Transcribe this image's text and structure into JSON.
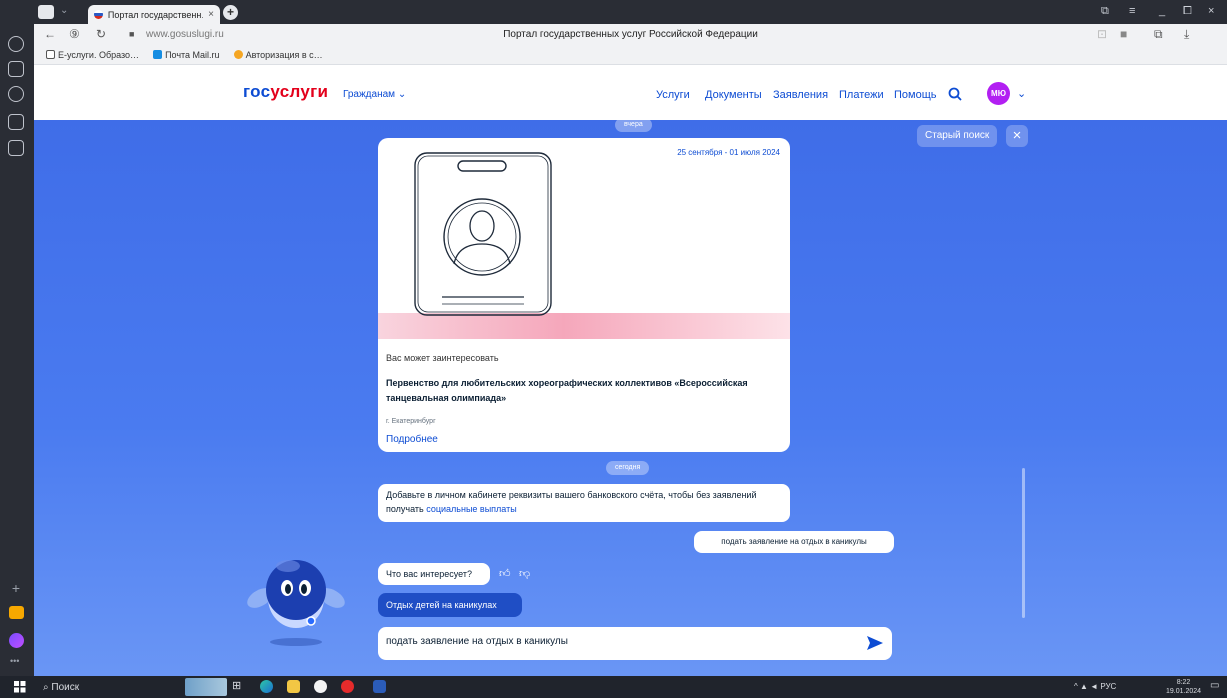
{
  "browser": {
    "tab_title": "Портал государственн…",
    "url": "www.gosuslugi.ru",
    "page_title": "Портал государственных услуг Российской Федерации",
    "bookmarks": [
      "Е-услуги. Образо…",
      "Почта Mail.ru",
      "Авторизация в с…"
    ]
  },
  "header": {
    "logo_part1": "гос",
    "logo_part2": "услуги",
    "citizens_menu": "Гражданам",
    "nav": [
      "Услуги",
      "Документы",
      "Заявления",
      "Платежи",
      "Помощь"
    ],
    "avatar": "МЮ"
  },
  "chat": {
    "old_search": "Старый поиск",
    "date_yesterday": "вчера",
    "date_today": "сегодня",
    "card": {
      "date_range": "25 сентября - 01 июля 2024",
      "kicker": "Вас может заинтересовать",
      "title": "Первенство для любительских хореографических коллективов «Всероссийская танцевальная олимпиада»",
      "city": "г. Екатеринбург",
      "more": "Подробнее"
    },
    "bank_message_text": "Добавьте в личном кабинете реквизиты вашего банковского счёта, чтобы без заявлений получать ",
    "bank_message_link": "социальные выплаты",
    "user_message": "подать заявление на отдых в каникулы",
    "bot_question": "Что вас интересует?",
    "suggestion_chip": "Отдых детей на каникулах",
    "input_value": "подать заявление на отдых в каникулы"
  },
  "taskbar": {
    "search_placeholder": "Поиск",
    "lang": "РУС",
    "time": "8:22",
    "date": "19.01.2024"
  },
  "colors": {
    "brand_blue": "#0d4cd3",
    "brand_red": "#e3001b",
    "chat_bg": "#4a7bf0",
    "avatar": "#b21ff2"
  }
}
